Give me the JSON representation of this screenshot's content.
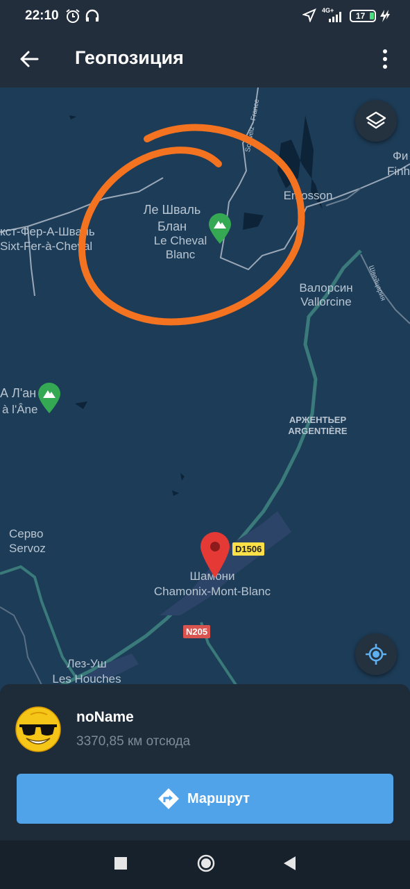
{
  "status_bar": {
    "time": "22:10",
    "icons": [
      "alarm-icon",
      "headphones-icon",
      "location-arrow-icon",
      "signal-4g-icon",
      "battery-icon",
      "charging-icon"
    ],
    "network": "4G+",
    "battery": "17"
  },
  "app_bar": {
    "title": "Геопозиция",
    "back_icon": "arrow-left-icon",
    "menu_icon": "more-vert-icon"
  },
  "map": {
    "border_label": "Schweiz - France",
    "border_label_2": "Швейцария",
    "places": {
      "cheval_ru": "Ле Шваль\nБлан",
      "cheval_fr": "Le Cheval\nBlanc",
      "sixt_ru": "кст-Фер-А-Шваль",
      "sixt_fr": "Sixt-Fer-à-Cheval",
      "emosson": "Emosson",
      "vallorcine_ru": "Валорсин",
      "vallorcine_fr": "Vallorcine",
      "fin_ru": "Фи",
      "fin_fr": "Finh",
      "ane_ru": "А Л'ан",
      "ane_fr": "à l'Âne",
      "argentiere_ru": "АРЖЕНТЬЕР",
      "argentiere_fr": "ARGENTIÈRE",
      "servoz_ru": "Серво",
      "servoz_fr": "Servoz",
      "chamonix_ru": "Шамони",
      "chamonix_fr": "Chamonix-Mont-Blanc",
      "houches_ru": "Лез-Уш",
      "houches_fr": "Les Houches"
    },
    "roads": {
      "d1506": "D1506",
      "n205": "N205"
    },
    "layers_icon": "layers-icon",
    "locate_icon": "my-location-icon",
    "annotation_color": "#f47321"
  },
  "sheet": {
    "name": "noName",
    "distance": "3370,85 км отсюда",
    "route_label": "Маршрут",
    "route_icon": "directions-icon",
    "accent": "#50a2e9"
  },
  "nav_bar": {
    "icons": [
      "recents-square-icon",
      "home-circle-icon",
      "back-triangle-icon"
    ]
  }
}
